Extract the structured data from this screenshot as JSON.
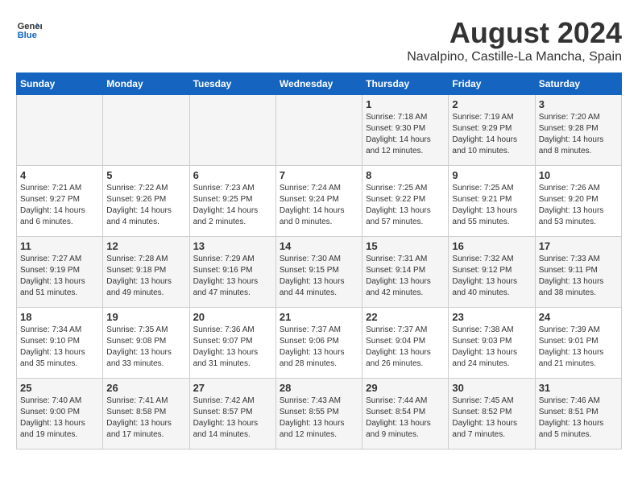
{
  "logo": {
    "text_general": "General",
    "text_blue": "Blue"
  },
  "title": "August 2024",
  "subtitle": "Navalpino, Castille-La Mancha, Spain",
  "headers": [
    "Sunday",
    "Monday",
    "Tuesday",
    "Wednesday",
    "Thursday",
    "Friday",
    "Saturday"
  ],
  "weeks": [
    [
      {
        "day": "",
        "info": ""
      },
      {
        "day": "",
        "info": ""
      },
      {
        "day": "",
        "info": ""
      },
      {
        "day": "",
        "info": ""
      },
      {
        "day": "1",
        "info": "Sunrise: 7:18 AM\nSunset: 9:30 PM\nDaylight: 14 hours\nand 12 minutes."
      },
      {
        "day": "2",
        "info": "Sunrise: 7:19 AM\nSunset: 9:29 PM\nDaylight: 14 hours\nand 10 minutes."
      },
      {
        "day": "3",
        "info": "Sunrise: 7:20 AM\nSunset: 9:28 PM\nDaylight: 14 hours\nand 8 minutes."
      }
    ],
    [
      {
        "day": "4",
        "info": "Sunrise: 7:21 AM\nSunset: 9:27 PM\nDaylight: 14 hours\nand 6 minutes."
      },
      {
        "day": "5",
        "info": "Sunrise: 7:22 AM\nSunset: 9:26 PM\nDaylight: 14 hours\nand 4 minutes."
      },
      {
        "day": "6",
        "info": "Sunrise: 7:23 AM\nSunset: 9:25 PM\nDaylight: 14 hours\nand 2 minutes."
      },
      {
        "day": "7",
        "info": "Sunrise: 7:24 AM\nSunset: 9:24 PM\nDaylight: 14 hours\nand 0 minutes."
      },
      {
        "day": "8",
        "info": "Sunrise: 7:25 AM\nSunset: 9:22 PM\nDaylight: 13 hours\nand 57 minutes."
      },
      {
        "day": "9",
        "info": "Sunrise: 7:25 AM\nSunset: 9:21 PM\nDaylight: 13 hours\nand 55 minutes."
      },
      {
        "day": "10",
        "info": "Sunrise: 7:26 AM\nSunset: 9:20 PM\nDaylight: 13 hours\nand 53 minutes."
      }
    ],
    [
      {
        "day": "11",
        "info": "Sunrise: 7:27 AM\nSunset: 9:19 PM\nDaylight: 13 hours\nand 51 minutes."
      },
      {
        "day": "12",
        "info": "Sunrise: 7:28 AM\nSunset: 9:18 PM\nDaylight: 13 hours\nand 49 minutes."
      },
      {
        "day": "13",
        "info": "Sunrise: 7:29 AM\nSunset: 9:16 PM\nDaylight: 13 hours\nand 47 minutes."
      },
      {
        "day": "14",
        "info": "Sunrise: 7:30 AM\nSunset: 9:15 PM\nDaylight: 13 hours\nand 44 minutes."
      },
      {
        "day": "15",
        "info": "Sunrise: 7:31 AM\nSunset: 9:14 PM\nDaylight: 13 hours\nand 42 minutes."
      },
      {
        "day": "16",
        "info": "Sunrise: 7:32 AM\nSunset: 9:12 PM\nDaylight: 13 hours\nand 40 minutes."
      },
      {
        "day": "17",
        "info": "Sunrise: 7:33 AM\nSunset: 9:11 PM\nDaylight: 13 hours\nand 38 minutes."
      }
    ],
    [
      {
        "day": "18",
        "info": "Sunrise: 7:34 AM\nSunset: 9:10 PM\nDaylight: 13 hours\nand 35 minutes."
      },
      {
        "day": "19",
        "info": "Sunrise: 7:35 AM\nSunset: 9:08 PM\nDaylight: 13 hours\nand 33 minutes."
      },
      {
        "day": "20",
        "info": "Sunrise: 7:36 AM\nSunset: 9:07 PM\nDaylight: 13 hours\nand 31 minutes."
      },
      {
        "day": "21",
        "info": "Sunrise: 7:37 AM\nSunset: 9:06 PM\nDaylight: 13 hours\nand 28 minutes."
      },
      {
        "day": "22",
        "info": "Sunrise: 7:37 AM\nSunset: 9:04 PM\nDaylight: 13 hours\nand 26 minutes."
      },
      {
        "day": "23",
        "info": "Sunrise: 7:38 AM\nSunset: 9:03 PM\nDaylight: 13 hours\nand 24 minutes."
      },
      {
        "day": "24",
        "info": "Sunrise: 7:39 AM\nSunset: 9:01 PM\nDaylight: 13 hours\nand 21 minutes."
      }
    ],
    [
      {
        "day": "25",
        "info": "Sunrise: 7:40 AM\nSunset: 9:00 PM\nDaylight: 13 hours\nand 19 minutes."
      },
      {
        "day": "26",
        "info": "Sunrise: 7:41 AM\nSunset: 8:58 PM\nDaylight: 13 hours\nand 17 minutes."
      },
      {
        "day": "27",
        "info": "Sunrise: 7:42 AM\nSunset: 8:57 PM\nDaylight: 13 hours\nand 14 minutes."
      },
      {
        "day": "28",
        "info": "Sunrise: 7:43 AM\nSunset: 8:55 PM\nDaylight: 13 hours\nand 12 minutes."
      },
      {
        "day": "29",
        "info": "Sunrise: 7:44 AM\nSunset: 8:54 PM\nDaylight: 13 hours\nand 9 minutes."
      },
      {
        "day": "30",
        "info": "Sunrise: 7:45 AM\nSunset: 8:52 PM\nDaylight: 13 hours\nand 7 minutes."
      },
      {
        "day": "31",
        "info": "Sunrise: 7:46 AM\nSunset: 8:51 PM\nDaylight: 13 hours\nand 5 minutes."
      }
    ]
  ]
}
